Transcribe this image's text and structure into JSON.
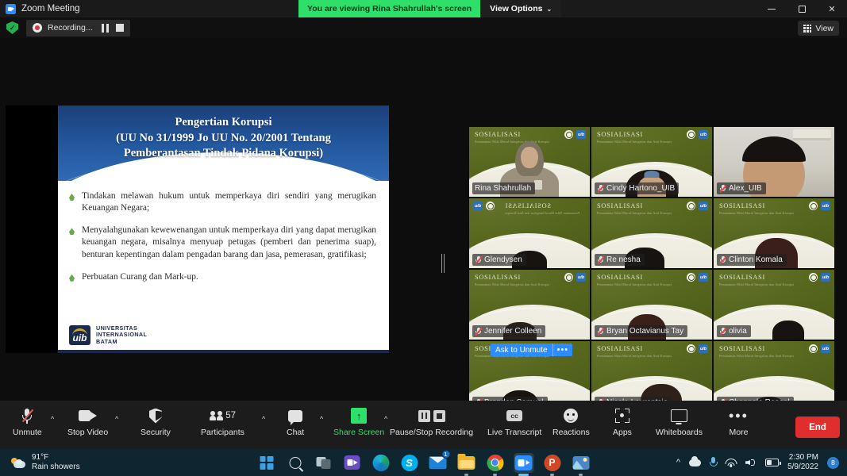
{
  "titlebar": {
    "app_title": "Zoom Meeting",
    "share_banner": "You are viewing Rina Shahrullah's screen",
    "view_options": "View Options",
    "caret": "⌄",
    "minimize": "—",
    "maximize": "❐",
    "close": "✕"
  },
  "recording_bar": {
    "status_text": "Recording...",
    "view_label": "View"
  },
  "slide": {
    "title_line1": "Pengertian Korupsi",
    "title_line2": "(UU No 31/1999 Jo UU No. 20/2001 Tentang",
    "title_line3": "Pemberantasan Tindak Pidana Korupsi)",
    "bullets": [
      "Tindakan melawan hukum untuk memperkaya diri sendiri yang merugikan Keuangan Negara;",
      "Menyalahgunakan kewewenangan untuk memperkaya diri yang dapat merugikan keuangan negara, misalnya menyuap petugas (pemberi dan penerima suap), benturan kepentingan dalam pengadan barang dan jasa, pemerasan, gratifikasi;",
      "Perbuatan Curang dan Mark-up."
    ],
    "logo_mark": "uib",
    "logo_lines": [
      "UNIVERSITAS",
      "INTERNASIONAL",
      "BATAM"
    ]
  },
  "video_grid": {
    "virtual_bg_title": "SOSIALISASI",
    "virtual_bg_sub": "Penanaman Nilai Moral Integritas dan Anti Korupsi",
    "bg_badge": "uib",
    "ask_to_unmute": "Ask to Unmute",
    "ask_more": "•••",
    "scroll_down": "⌄",
    "tiles": [
      {
        "name": "Rina Shahrullah",
        "muted": false,
        "active": true,
        "bg": "green-person"
      },
      {
        "name": "Cindy Hartono_UIB",
        "muted": true,
        "active": false,
        "bg": "green-cindy"
      },
      {
        "name": "Alex_UIB",
        "muted": true,
        "active": false,
        "bg": "room"
      },
      {
        "name": "Glendysen",
        "muted": true,
        "active": false,
        "bg": "green-flip"
      },
      {
        "name": "Re nesha",
        "muted": true,
        "active": false,
        "bg": "green"
      },
      {
        "name": "Clinton Komala",
        "muted": true,
        "active": false,
        "bg": "green"
      },
      {
        "name": "Jennifer Colleen",
        "muted": true,
        "active": false,
        "bg": "green"
      },
      {
        "name": "Bryan Octavianus Tay",
        "muted": true,
        "active": false,
        "bg": "green"
      },
      {
        "name": "olivia",
        "muted": true,
        "active": false,
        "bg": "green"
      },
      {
        "name": "Brandon Samuel",
        "muted": true,
        "active": false,
        "bg": "green"
      },
      {
        "name": "Nicole Lourentsia",
        "muted": true,
        "active": false,
        "bg": "green"
      },
      {
        "name": "Channele Rosenl",
        "muted": true,
        "active": false,
        "bg": "green"
      }
    ]
  },
  "toolbar": {
    "unmute": "Unmute",
    "stop_video": "Stop Video",
    "security": "Security",
    "participants": "Participants",
    "participant_count": "57",
    "chat": "Chat",
    "share_screen": "Share Screen",
    "pause_stop_recording": "Pause/Stop Recording",
    "live_transcript": "Live Transcript",
    "cc_label": "cc",
    "reactions": "Reactions",
    "apps": "Apps",
    "whiteboards": "Whiteboards",
    "more": "More",
    "more_dots": "•••",
    "end": "End",
    "chevron": "^"
  },
  "taskbar": {
    "weather_temp": "91°F",
    "weather_desc": "Rain showers",
    "mail_badge": "1",
    "skype_letter": "S",
    "ppt_letter": "P",
    "tray_chevron": "^",
    "time": "2:30 PM",
    "date": "5/9/2022",
    "notification_count": "8"
  }
}
